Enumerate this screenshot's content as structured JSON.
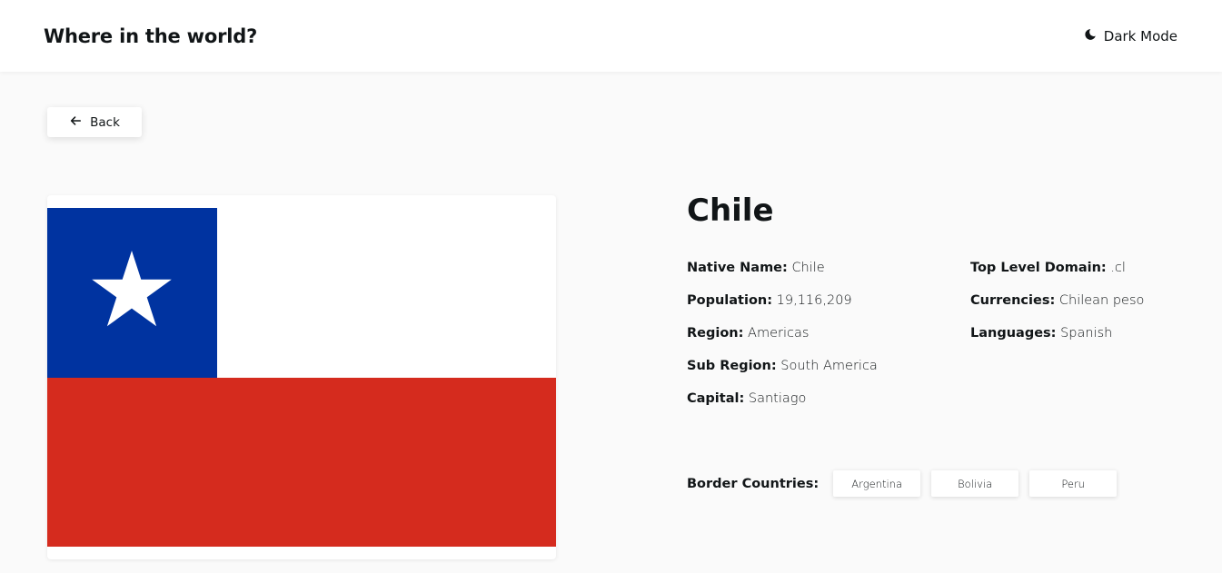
{
  "header": {
    "title": "Where in the world?",
    "dark_mode_label": "Dark Mode",
    "dark_mode_icon": "moon-icon"
  },
  "back_button": {
    "label": "Back",
    "icon": "arrow-left-icon"
  },
  "flag": {
    "colors": {
      "blue": "#0033a0",
      "white": "#ffffff",
      "red": "#d52b1e",
      "star": "#ffffff"
    }
  },
  "country": {
    "name": "Chile",
    "details_left": [
      {
        "label": "Native Name:",
        "value": "Chile"
      },
      {
        "label": "Population:",
        "value": "19,116,209"
      },
      {
        "label": "Region:",
        "value": "Americas"
      },
      {
        "label": "Sub Region:",
        "value": "South America"
      },
      {
        "label": "Capital:",
        "value": "Santiago"
      }
    ],
    "details_right": [
      {
        "label": "Top Level Domain:",
        "value": ".cl"
      },
      {
        "label": "Currencies:",
        "value": "Chilean peso"
      },
      {
        "label": "Languages:",
        "value": "Spanish"
      }
    ],
    "border_countries_label": "Border Countries:",
    "border_countries": [
      "Argentina",
      "Bolivia",
      "Peru"
    ]
  }
}
